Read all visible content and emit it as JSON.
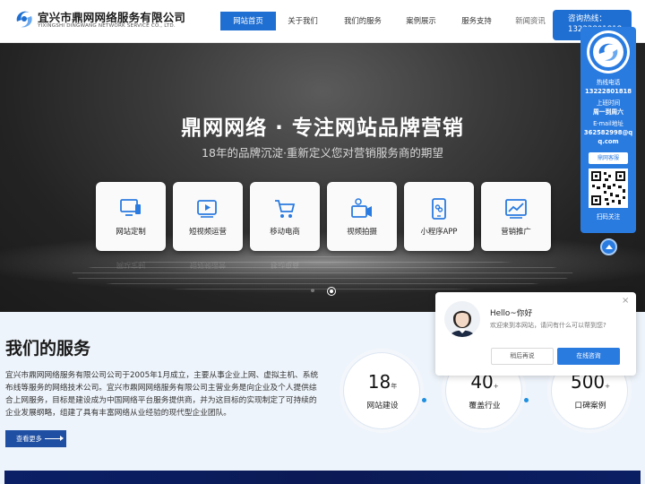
{
  "header": {
    "company_cn": "宜兴市鼎网网络服务有限公司",
    "company_en": "YIXINGSHI DINGWANG NETWORK SERVICE CO., LTD.",
    "nav": [
      {
        "label": "网站首页",
        "icon": "none"
      },
      {
        "label": "关于我们"
      },
      {
        "label": "我们的服务"
      },
      {
        "label": "案例展示"
      },
      {
        "label": "服务支持"
      },
      {
        "label": "新闻资讯"
      }
    ],
    "hotline_label": "咨询热线：",
    "hotline_number": "13222801818"
  },
  "banner": {
    "title": "鼎网网络 · 专注网站品牌营销",
    "subtitle": "18年的品牌沉淀·重新定义您对营销服务商的期望",
    "cards": [
      {
        "label": "网站定制",
        "icon": "monitor-icon"
      },
      {
        "label": "短视频运营",
        "icon": "video-play-icon"
      },
      {
        "label": "移动电商",
        "icon": "shopping-cart-icon"
      },
      {
        "label": "视频拍摄",
        "icon": "camera-icon"
      },
      {
        "label": "小程序APP",
        "icon": "mobile-app-icon"
      },
      {
        "label": "营销推广",
        "icon": "trend-chart-icon"
      }
    ],
    "slide_count": 2,
    "active_slide": 2
  },
  "services": {
    "title": "我们的服务",
    "description": "宜兴市鼎网网络服务有限公司公司于2005年1月成立，主要从事企业上网、虚拟主机、系统布线等服务的网络技术公司。宜兴市鼎网网络服务有限公司主营业务是向企业及个人提供综合上网服务，目标是建设成为中国网络平台服务提供商，并为这目标的实现制定了可持续的企业发展纲略，组建了具有丰富网络从业经验的现代型企业团队。",
    "more_label": "查看更多",
    "stats": [
      {
        "number": "18",
        "unit": "年",
        "label": "网站建设"
      },
      {
        "number": "40",
        "unit": "+",
        "label": "覆盖行业"
      },
      {
        "number": "500",
        "unit": "+",
        "label": "口碑案例"
      }
    ]
  },
  "side_panel": {
    "hotline_label": "热线电话",
    "hotline_number": "13222801818",
    "hours_label": "上班时间",
    "hours_value": "周一到周六",
    "email_label": "E-mail地址",
    "email_line1": "362582998@q",
    "email_line2": "q.com",
    "service_button": "鼎网客服",
    "qr_caption": "扫码关注"
  },
  "chat": {
    "hello": "Hello~你好",
    "message": "欢迎来到本网站，请问有什么可以帮到您?",
    "later_label": "稍后再说",
    "consult_label": "在线咨询",
    "close_symbol": "×"
  },
  "colors": {
    "brand_blue": "#1f6fd2",
    "panel_blue": "#2a7be0",
    "dark_navy": "#0a1f66"
  }
}
